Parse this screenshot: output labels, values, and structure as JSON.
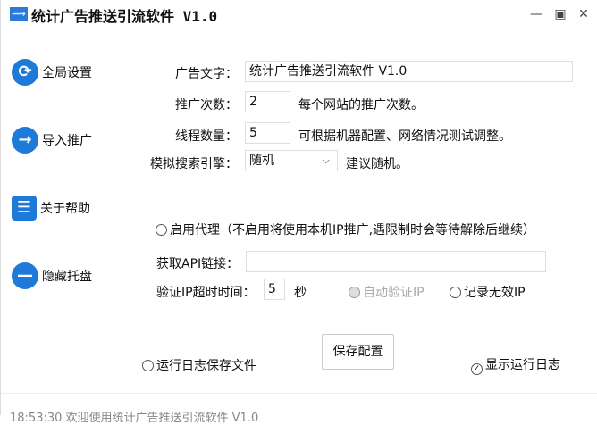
{
  "title": "统计广告推送引流软件 V1.0",
  "window": {
    "minimize": "—",
    "maximize": "▣",
    "close": "✕"
  },
  "nav": [
    {
      "label": "全局设置",
      "icon": "⟳"
    },
    {
      "label": "导入推广",
      "icon": "→"
    },
    {
      "label": "关于帮助",
      "icon": "☰"
    },
    {
      "label": "隐藏托盘",
      "icon": "—"
    }
  ],
  "form": {
    "ad_text_label": "广告文字：",
    "ad_text_value": "统计广告推送引流软件 V1.0",
    "count_label": "推广次数：",
    "count_value": "2",
    "count_hint": "每个网站的推广次数。",
    "threads_label": "线程数量：",
    "threads_value": "5",
    "threads_hint": "可根据机器配置、网络情况测试调整。",
    "engine_label": "模拟搜索引擎：",
    "engine_value": "随机",
    "engine_hint": "建议随机。"
  },
  "proxy": {
    "enable_label": "启用代理（不启用将使用本机IP推广,遇限制时会等待解除后继续）",
    "api_label": "获取API链接：",
    "api_value": "",
    "timeout_label": "验证IP超时时间：",
    "timeout_value": "5",
    "timeout_unit": "秒",
    "auto_verify_label": "自动验证IP",
    "record_invalid_label": "记录无效IP"
  },
  "bottom": {
    "save_log_label": "运行日志保存文件",
    "save_button": "保存配置",
    "show_log_label": "显示运行日志",
    "show_log_checked": true
  },
  "log": "18:53:30 欢迎使用统计广告推送引流软件 V1.0"
}
